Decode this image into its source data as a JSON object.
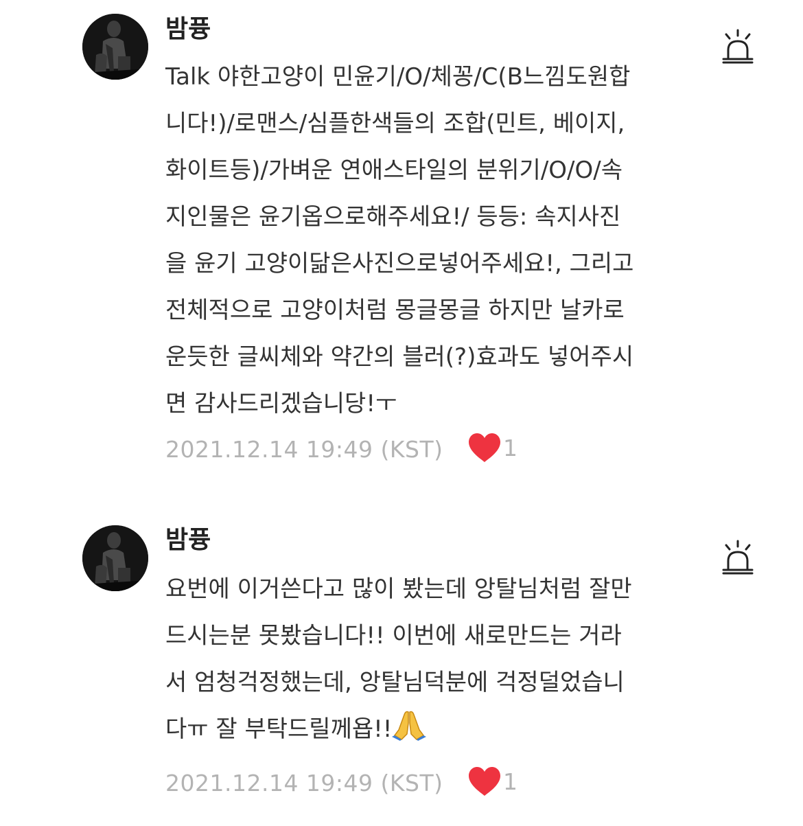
{
  "comments": [
    {
      "author": "밤퓽",
      "body": "Talk 야한고양이 민윤기/O/체꽁/C(B느낌도원합\n니다!)/로맨스/심플한색들의 조합(민트, 베이지,\n화이트등)/가벼운 연애스타일의 분위기/O/O/속\n지인물은 윤기옵으로해주세요!/ 등등: 속지사진\n을 윤기 고양이닮은사진으로넣어주세요!, 그리고\n전체적으로 고양이처럼 몽글몽글 하지만 날카로\n운듯한 글씨체와 약간의 블러(?)효과도 넣어주시\n면 감사드리겠습니당!ㅜ",
      "timestamp": "2021.12.14 19:49 (KST)",
      "likes": "1",
      "heart_color": "#ee3340",
      "report_icon": "siren-icon"
    },
    {
      "author": "밤퓽",
      "body": "요번에 이거쓴다고 많이 봤는데 앙탈님처럼 잘만\n드시는분 못봤습니다!! 이번에 새로만드는 거라\n서 엄청걱정했는데, 앙탈님덕분에 걱정덜었습니\n다ㅠ 잘 부탁드릴께욥!!",
      "emoji": "folded-hands",
      "timestamp": "2021.12.14 19:49 (KST)",
      "likes": "1",
      "heart_color": "#ee3340",
      "report_icon": "siren-icon"
    }
  ]
}
